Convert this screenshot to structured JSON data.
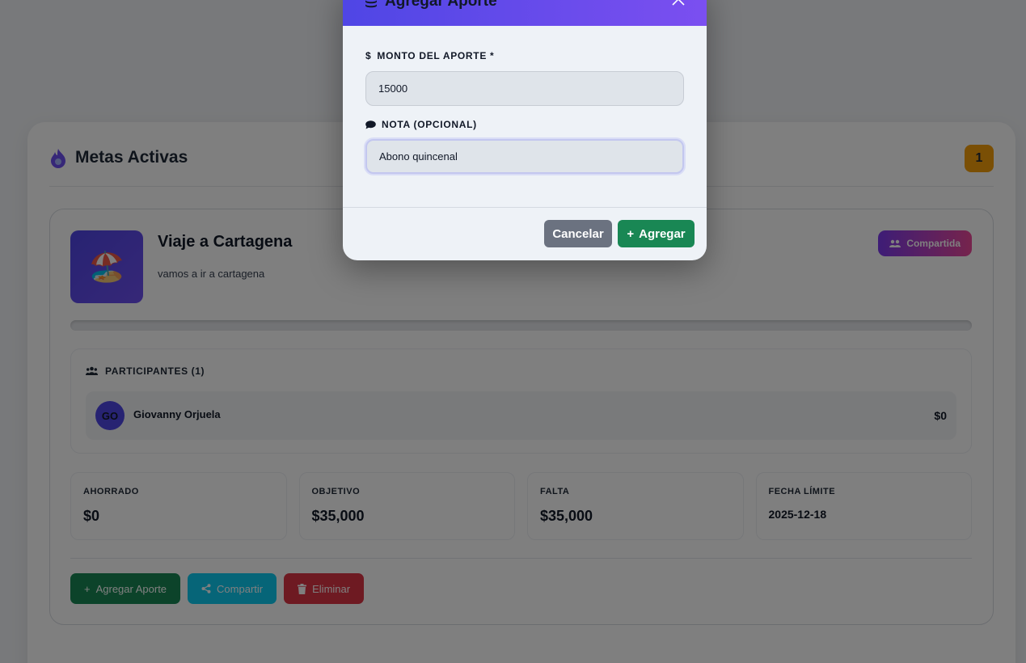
{
  "page": {
    "section_title": "Metas Activas",
    "active_count": "1"
  },
  "goal": {
    "emoji": "🏖️",
    "name": "Viaje a Cartagena",
    "description": "vamos a ir a cartagena",
    "shared_label": "Compartida",
    "progress_fraction": 0.0,
    "participants_title": "PARTICIPANTES (1)",
    "participants": [
      {
        "initials": "GO",
        "name": "Giovanny Orjuela",
        "amount": "$0"
      }
    ],
    "stats": [
      {
        "label": "AHORRADO",
        "value": "$0"
      },
      {
        "label": "OBJETIVO",
        "value": "$35,000"
      },
      {
        "label": "FALTA",
        "value": "$35,000"
      },
      {
        "label": "FECHA LÍMITE",
        "value": "2025-12-18"
      }
    ],
    "actions": {
      "add_label": "Agregar Aporte",
      "share_label": "Compartir",
      "delete_label": "Eliminar"
    }
  },
  "modal": {
    "title": "Agregar Aporte",
    "amount_label": "MONTO DEL APORTE *",
    "amount_value": "15000",
    "note_label": "NOTA (OPCIONAL)",
    "note_value": "Abono quincenal",
    "cancel_label": "Cancelar",
    "submit_label": "Agregar"
  },
  "colors": {
    "primary": "#4f46e5",
    "accent": "#7b4ff0",
    "success": "#198754",
    "info": "#0dcaf0",
    "danger": "#dc3545",
    "warning": "#f59e0b"
  }
}
